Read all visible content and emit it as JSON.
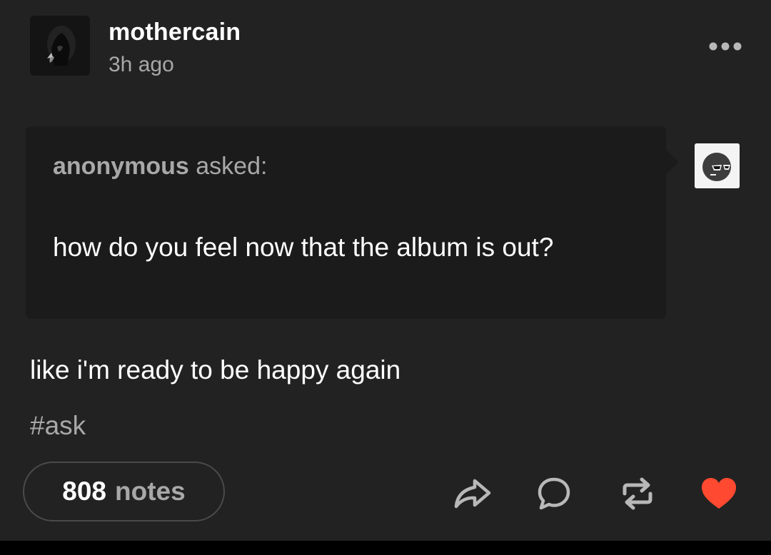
{
  "post": {
    "author": "mothercain",
    "timestamp": "3h ago",
    "more_icon": "ellipsis-icon",
    "ask": {
      "asker": "anonymous",
      "asked_label": "asked:",
      "question": "how do you feel now that the album is out?",
      "asker_avatar_icon": "anonymous-sunglasses-avatar"
    },
    "answer": "like i'm ready to be happy again",
    "tags": [
      "#ask"
    ],
    "footer": {
      "notes_count": "808",
      "notes_label": "notes",
      "actions": [
        "share-icon",
        "reply-icon",
        "reblog-icon",
        "like-heart-icon"
      ],
      "like_color": "#ff4930"
    }
  },
  "colors": {
    "background": "#222222",
    "ask_background": "#1b1b1b",
    "text_primary": "#ffffff",
    "text_secondary": "#a8a8a8"
  }
}
